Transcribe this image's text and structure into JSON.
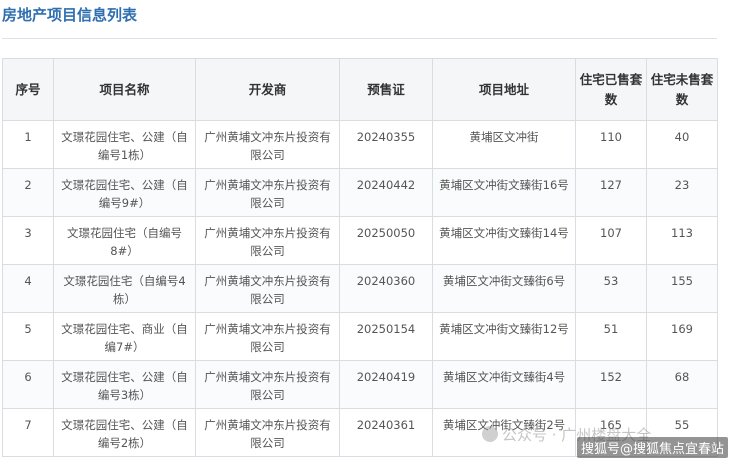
{
  "title": "房地产项目信息列表",
  "table": {
    "headers": [
      "序号",
      "项目名称",
      "开发商",
      "预售证",
      "项目地址",
      "住宅已售套数",
      "住宅未售套数"
    ],
    "rows": [
      [
        "1",
        "文璟花园住宅、公建（自编号1栋）",
        "广州黄埔文冲东片投资有限公司",
        "20240355",
        "黄埔区文冲街",
        "110",
        "40"
      ],
      [
        "2",
        "文璟花园住宅、公建（自编号9#）",
        "广州黄埔文冲东片投资有限公司",
        "20240442",
        "黄埔区文冲街文臻街16号",
        "127",
        "23"
      ],
      [
        "3",
        "文璟花园住宅（自编号8#）",
        "广州黄埔文冲东片投资有限公司",
        "20250050",
        "黄埔区文冲街文臻街14号",
        "107",
        "113"
      ],
      [
        "4",
        "文璟花园住宅（自编号4栋）",
        "广州黄埔文冲东片投资有限公司",
        "20240360",
        "黄埔区文冲街文臻街6号",
        "53",
        "155"
      ],
      [
        "5",
        "文璟花园住宅、商业（自编7#）",
        "广州黄埔文冲东片投资有限公司",
        "20250154",
        "黄埔区文冲街文臻街12号",
        "51",
        "169"
      ],
      [
        "6",
        "文璟花园住宅、公建（自编号3栋）",
        "广州黄埔文冲东片投资有限公司",
        "20240419",
        "黄埔区文冲街文臻街4号",
        "152",
        "68"
      ],
      [
        "7",
        "文璟花园住宅、公建（自编号2栋）",
        "广州黄埔文冲东片投资有限公司",
        "20240361",
        "黄埔区文冲街文臻街2号",
        "165",
        "55"
      ]
    ]
  },
  "watermark": "公众号 · 广州楼盘大全",
  "source": "搜狐号@搜狐焦点宜春站"
}
